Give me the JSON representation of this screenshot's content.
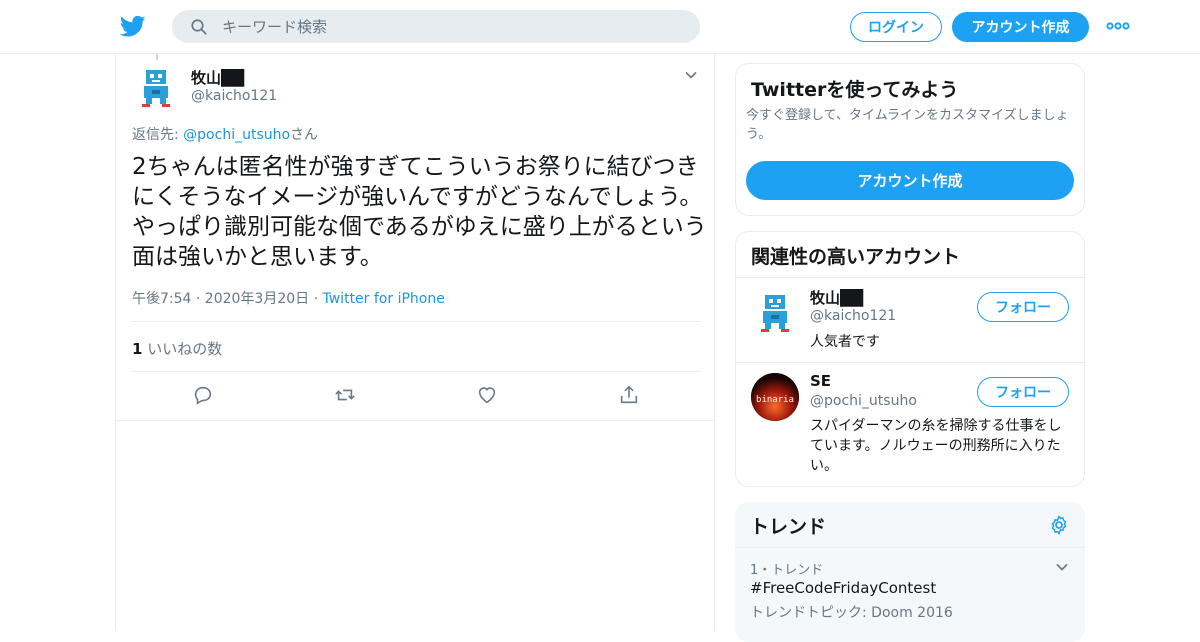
{
  "header": {
    "search_placeholder": "キーワード検索",
    "login_label": "ログイン",
    "signup_label": "アカウント作成"
  },
  "tweet": {
    "author_name": "牧山██",
    "author_handle": "@kaicho121",
    "reply_prefix": "返信先: ",
    "reply_handle": "@pochi_utsuho",
    "reply_suffix": "さん",
    "text": "2ちゃんは匿名性が強すぎてこういうお祭りに結びつきにくそうなイメージが強いんですがどうなんでしょう。やっぱり識別可能な個であるがゆえに盛り上がるという面は強いかと思います。",
    "timestamp": "午後7:54 · 2020年3月20日",
    "separator": " · ",
    "source": "Twitter for iPhone",
    "like_count": "1",
    "like_label": " いいねの数"
  },
  "signup_card": {
    "title": "Twitterを使ってみよう",
    "description": "今すぐ登録して、タイムラインをカスタマイズしましょう。",
    "button_label": "アカウント作成"
  },
  "related": {
    "title": "関連性の高いアカウント",
    "follow_label": "フォロー",
    "accounts": [
      {
        "name": "牧山██",
        "handle": "@kaicho121",
        "bio": "人気者です"
      },
      {
        "name": "SE",
        "handle": "@pochi_utsuho",
        "bio": "スパイダーマンの糸を掃除する仕事をしています。ノルウェーの刑務所に入りたい。",
        "avatar_text": "binaria"
      }
    ]
  },
  "trends": {
    "title": "トレンド",
    "items": [
      {
        "meta": "1・トレンド",
        "tag": "#FreeCodeFridayContest",
        "topic": "トレンドトピック: Doom 2016"
      }
    ]
  },
  "colors": {
    "brand": "#1da1f2",
    "link": "#1b95e0",
    "secondary_text": "#657786",
    "border": "#e6ecf0"
  },
  "icons": [
    "twitter-bird-icon",
    "search-icon",
    "more-icon",
    "chevron-down-icon",
    "reply-icon",
    "retweet-icon",
    "like-icon",
    "share-icon",
    "settings-gear-icon"
  ]
}
